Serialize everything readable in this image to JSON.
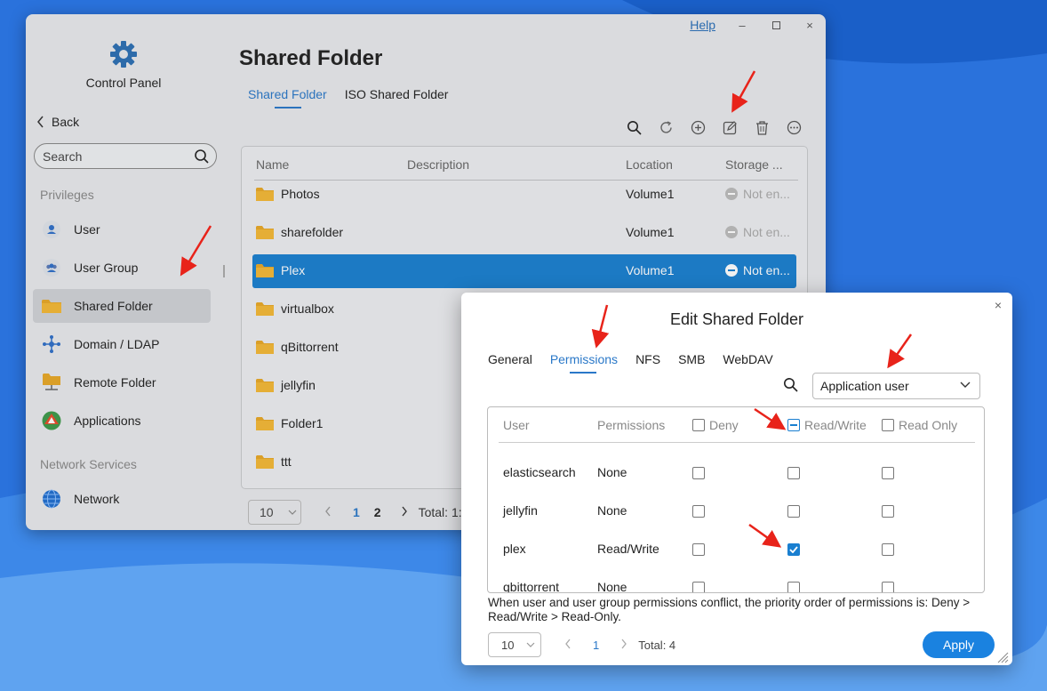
{
  "window": {
    "help": "Help",
    "min": "–",
    "max": "▢",
    "close": "×"
  },
  "sidebar": {
    "title": "Control Panel",
    "back": "Back",
    "search_placeholder": "Search",
    "sections": [
      "Privileges",
      "Network Services"
    ],
    "items": [
      {
        "label": "User",
        "icon": "user-icon"
      },
      {
        "label": "User Group",
        "icon": "user-group-icon"
      },
      {
        "label": "Shared Folder",
        "icon": "folder-icon",
        "active": true
      },
      {
        "label": "Domain / LDAP",
        "icon": "domain-icon"
      },
      {
        "label": "Remote Folder",
        "icon": "remote-folder-icon"
      },
      {
        "label": "Applications",
        "icon": "applications-icon"
      },
      {
        "label": "Network",
        "icon": "network-icon"
      }
    ]
  },
  "main": {
    "title": "Shared Folder",
    "tabs": [
      "Shared Folder",
      "ISO Shared Folder"
    ],
    "columns": [
      "Name",
      "Description",
      "Location",
      "Storage ..."
    ],
    "rows": [
      {
        "name": "Photos",
        "location": "Volume1",
        "storage": "Not en..."
      },
      {
        "name": "sharefolder",
        "location": "Volume1",
        "storage": "Not en..."
      },
      {
        "name": "Plex",
        "location": "Volume1",
        "storage": "Not en...",
        "selected": true
      },
      {
        "name": "virtualbox",
        "location": "",
        "storage": ""
      },
      {
        "name": "qBittorrent",
        "location": "",
        "storage": ""
      },
      {
        "name": "jellyfin",
        "location": "",
        "storage": ""
      },
      {
        "name": "Folder1",
        "location": "",
        "storage": ""
      },
      {
        "name": "ttt",
        "location": "",
        "storage": ""
      }
    ],
    "pager": {
      "page_size": "10",
      "pages": [
        "1",
        "2"
      ],
      "total": "Total: 1:"
    }
  },
  "dialog": {
    "title": "Edit Shared Folder",
    "close": "×",
    "tabs": [
      "General",
      "Permissions",
      "NFS",
      "SMB",
      "WebDAV"
    ],
    "filter": "Application user",
    "columns": [
      "User",
      "Permissions",
      "Deny",
      "Read/Write",
      "Read Only"
    ],
    "rows": [
      {
        "user": "elasticsearch",
        "perm": "None",
        "deny": false,
        "rw": false,
        "ro": false
      },
      {
        "user": "jellyfin",
        "perm": "None",
        "deny": false,
        "rw": false,
        "ro": false
      },
      {
        "user": "plex",
        "perm": "Read/Write",
        "deny": false,
        "rw": true,
        "ro": false
      },
      {
        "user": "qbittorrent",
        "perm": "None",
        "deny": false,
        "rw": false,
        "ro": false
      }
    ],
    "note": "When user and user group permissions conflict, the priority order of permissions is: Deny > Read/Write > Read-Only.",
    "pager": {
      "page_size": "10",
      "page": "1",
      "total": "Total: 4"
    },
    "apply": "Apply"
  },
  "colors": {
    "accent": "#1a7fd0",
    "arrow": "#e8231a"
  }
}
